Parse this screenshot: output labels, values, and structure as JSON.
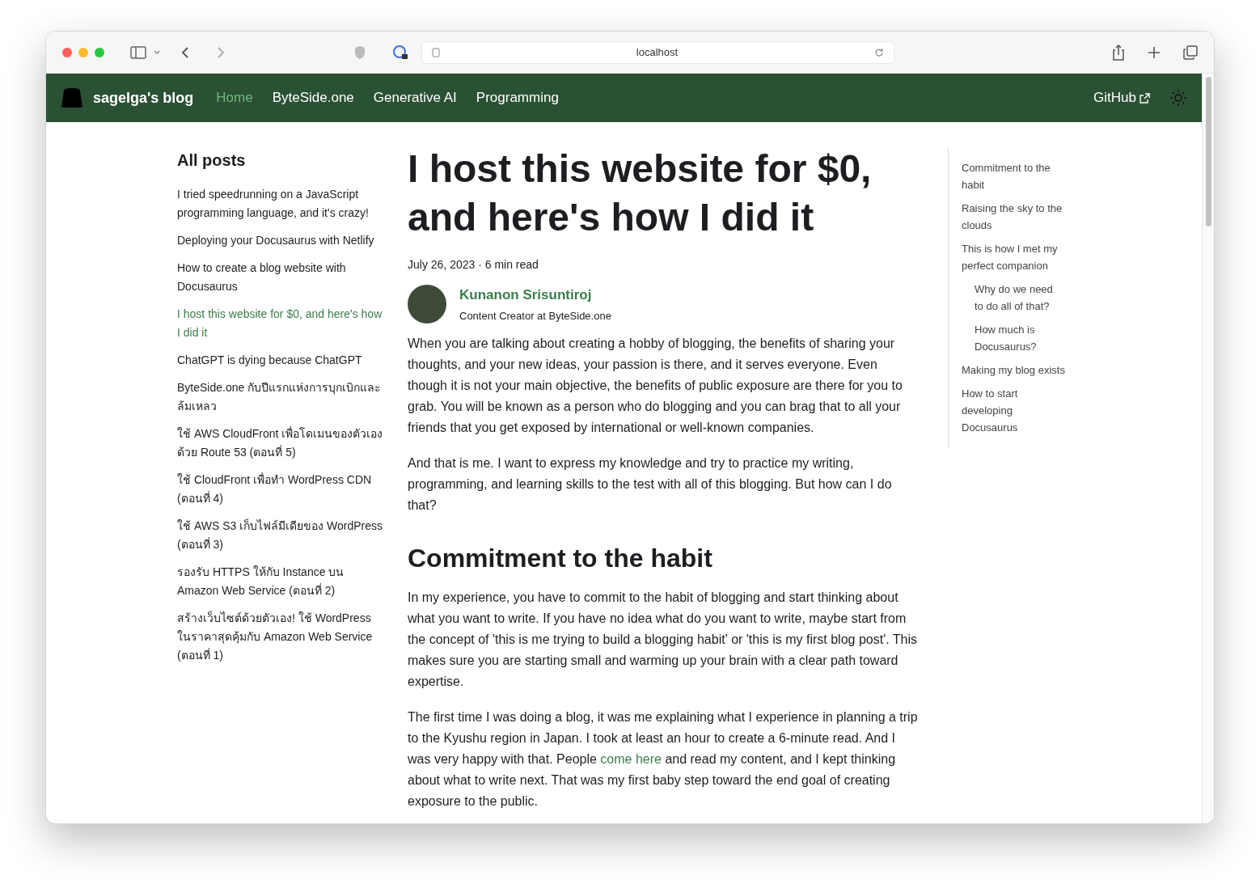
{
  "browser": {
    "url": "localhost"
  },
  "navbar": {
    "brand": "sagelga's blog",
    "links": [
      {
        "label": "Home",
        "selected": true
      },
      {
        "label": "ByteSide.one",
        "selected": false
      },
      {
        "label": "Generative AI",
        "selected": false
      },
      {
        "label": "Programming",
        "selected": false
      }
    ],
    "github": "GitHub"
  },
  "sidebar": {
    "title": "All posts",
    "posts": [
      {
        "title": "I tried speedrunning on a JavaScript programming language, and it's crazy!",
        "selected": false
      },
      {
        "title": "Deploying your Docusaurus with Netlify",
        "selected": false
      },
      {
        "title": "How to create a blog website with Docusaurus",
        "selected": false
      },
      {
        "title": "I host this website for $0, and here's how I did it",
        "selected": true
      },
      {
        "title": "ChatGPT is dying because ChatGPT",
        "selected": false
      },
      {
        "title": "ByteSide.one กับปีแรกแห่งการบุกเบิกและล้มเหลว",
        "selected": false
      },
      {
        "title": "ใช้ AWS CloudFront เพื่อโดเมนของตัวเองด้วย Route 53 (ตอนที่ 5)",
        "selected": false
      },
      {
        "title": "ใช้ CloudFront เพื่อทำ WordPress CDN (ตอนที่ 4)",
        "selected": false
      },
      {
        "title": "ใช้ AWS S3 เก็บไฟล์มีเดียของ WordPress (ตอนที่ 3)",
        "selected": false
      },
      {
        "title": "รองรับ HTTPS ให้กับ Instance บน Amazon Web Service (ตอนที่ 2)",
        "selected": false
      },
      {
        "title": "สร้างเว็บไซต์ด้วยตัวเอง! ใช้ WordPress ในราคาสุดคุ้มกับ Amazon Web Service (ตอนที่ 1)",
        "selected": false
      }
    ]
  },
  "article": {
    "title": "I host this website for $0, and here's how I did it",
    "meta": "July 26, 2023 · 6 min read",
    "author": {
      "name": "Kunanon Srisuntiroj",
      "role": "Content Creator at ByteSide.one"
    },
    "blocks": [
      {
        "kind": "paragraph",
        "parts": [
          {
            "kind": "text",
            "text": "When you are talking about creating a hobby of blogging, the benefits of sharing your thoughts, and your new ideas, your passion is there, and it serves everyone. Even though it is not your main objective, the benefits of public exposure are there for you to grab. You will be known as a person who do blogging and you can brag that to all your friends that you get exposed by international or well-known companies."
          }
        ]
      },
      {
        "kind": "paragraph",
        "parts": [
          {
            "kind": "text",
            "text": "And that is me. I want to express my knowledge and try to practice my writing, programming, and learning skills to the test with all of this blogging. But how can I do that?"
          }
        ]
      },
      {
        "kind": "heading",
        "text": "Commitment to the habit"
      },
      {
        "kind": "paragraph",
        "parts": [
          {
            "kind": "text",
            "text": "In my experience, you have to commit to the habit of blogging and start thinking about what you want to write. If you have no idea what do you want to write, maybe start from the concept of 'this is me trying to build a blogging habit' or 'this is my first blog post'. This makes sure you are starting small and warming up your brain with a clear path toward expertise."
          }
        ]
      },
      {
        "kind": "paragraph",
        "parts": [
          {
            "kind": "text",
            "text": "The first time I was doing a blog, it was me explaining what I experience in planning a trip to the Kyushu region in Japan. I took at least an hour to create a 6-minute read. And I was very happy with that. People "
          },
          {
            "kind": "link",
            "text": "come here"
          },
          {
            "kind": "text",
            "text": " and read my content, and I kept thinking about what to write next. That was my first baby step toward the end goal of creating exposure to the public."
          }
        ]
      }
    ]
  },
  "toc": [
    {
      "label": "Commitment to the habit"
    },
    {
      "label": "Raising the sky to the clouds"
    },
    {
      "label": "This is how I met my perfect companion",
      "children": [
        {
          "label": "Why do we need to do all of that?"
        },
        {
          "label": "How much is Docusaurus?"
        }
      ]
    },
    {
      "label": "Making my blog exists"
    },
    {
      "label": "How to start developing Docusaurus"
    }
  ]
}
